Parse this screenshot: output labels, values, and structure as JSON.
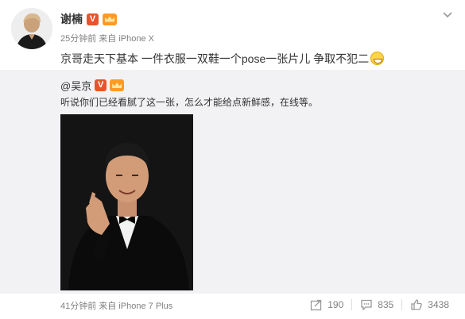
{
  "post": {
    "author": "谢楠",
    "verified_badge": "V",
    "meta": "25分钟前 来自 iPhone X",
    "text": "京哥走天下基本 一件衣服一双鞋一个pose一张片儿 争取不犯二"
  },
  "repost": {
    "author": "@吴京",
    "verified_badge": "V",
    "text": "听说你们已经看腻了这一张，怎么才能给点新鲜感，在线等。",
    "meta": "41分钟前 来自 iPhone 7 Plus"
  },
  "actions": {
    "forward_count": "190",
    "comment_count": "835",
    "like_count": "3438"
  },
  "icons": {
    "forward": "forward-icon",
    "comment": "comment-icon",
    "like": "thumbs-up-icon",
    "more": "chevron-down-icon",
    "member": "crown-icon",
    "emoji": "grin-emoji-icon"
  },
  "colors": {
    "verified": "#e8542a",
    "member": "#ff9a23",
    "meta_text": "#808080",
    "repost_bg": "#f2f2f5"
  }
}
